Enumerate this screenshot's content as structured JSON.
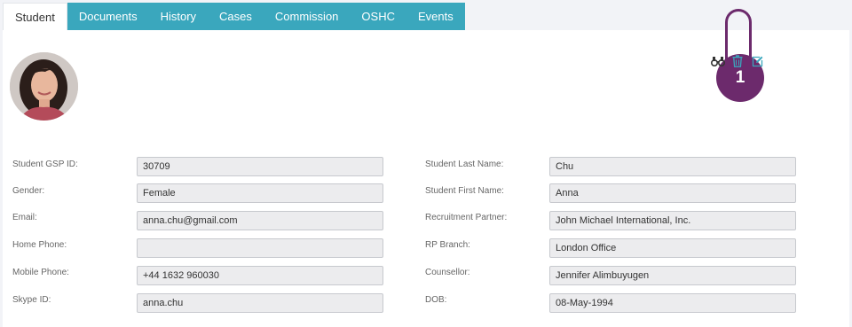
{
  "tabs": [
    {
      "label": "Student",
      "active": true
    },
    {
      "label": "Documents",
      "active": false
    },
    {
      "label": "History",
      "active": false
    },
    {
      "label": "Cases",
      "active": false
    },
    {
      "label": "Commission",
      "active": false
    },
    {
      "label": "OSHC",
      "active": false
    },
    {
      "label": "Events",
      "active": false
    }
  ],
  "actions": {
    "view_icon": "binoculars-icon",
    "delete_icon": "trash-icon",
    "edit_icon": "edit-icon"
  },
  "callout": {
    "number": "1",
    "color": "#6c2a6c"
  },
  "colors": {
    "tab_bg": "#3aa7bd",
    "accent": "#3aa7bd"
  },
  "left_fields": [
    {
      "label": "Student GSP ID:",
      "value": "30709"
    },
    {
      "label": "Gender:",
      "value": "Female"
    },
    {
      "label": "Email:",
      "value": "anna.chu@gmail.com"
    },
    {
      "label": "Home Phone:",
      "value": ""
    },
    {
      "label": "Mobile Phone:",
      "value": "+44 1632 960030"
    },
    {
      "label": "Skype ID:",
      "value": "anna.chu"
    }
  ],
  "right_fields": [
    {
      "label": "Student Last Name:",
      "value": "Chu"
    },
    {
      "label": "Student First Name:",
      "value": "Anna"
    },
    {
      "label": "Recruitment Partner:",
      "value": "John Michael International, Inc."
    },
    {
      "label": "RP Branch:",
      "value": "London Office"
    },
    {
      "label": "Counsellor:",
      "value": "Jennifer Alimbuyugen"
    },
    {
      "label": "DOB:",
      "value": "08-May-1994"
    }
  ]
}
